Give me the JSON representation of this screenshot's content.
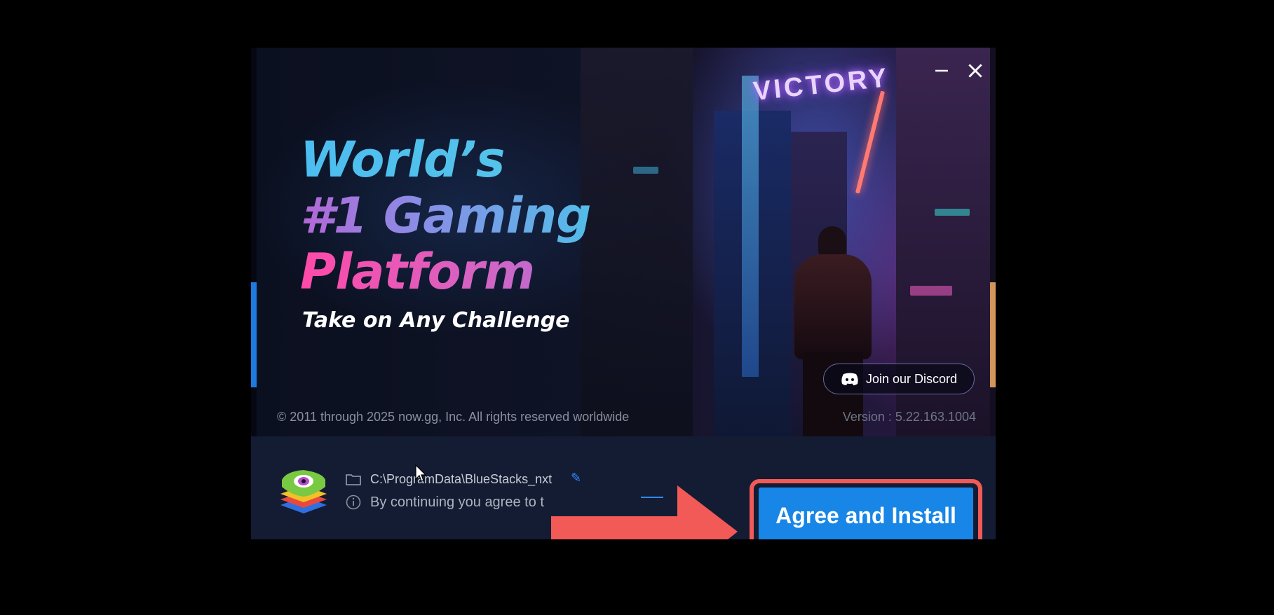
{
  "window": {
    "minimize_label": "Minimize",
    "close_label": "Close"
  },
  "hero": {
    "headline_line1": "World’s",
    "headline_line2": "#1 Gaming",
    "headline_line3": "Platform",
    "tagline": "Take on Any Challenge",
    "sign_text": "VICTORY",
    "discord_label": "Join our Discord",
    "copyright": "© 2011 through 2025 now.gg, Inc. All rights reserved worldwide",
    "version": "Version : 5.22.163.1004"
  },
  "footer": {
    "install_path": "C:\\ProgramData\\BlueStacks_nxt",
    "agreement_text": "By continuing you agree to t",
    "install_button": "Agree and Install"
  },
  "colors": {
    "accent_button": "#1786e6",
    "annotation_red": "#f25a57",
    "panel_bg": "#141c33"
  },
  "icons": [
    "minimize-icon",
    "close-icon",
    "discord-icon",
    "folder-icon",
    "info-icon",
    "edit-icon",
    "bluestacks-logo",
    "mouse-cursor"
  ]
}
